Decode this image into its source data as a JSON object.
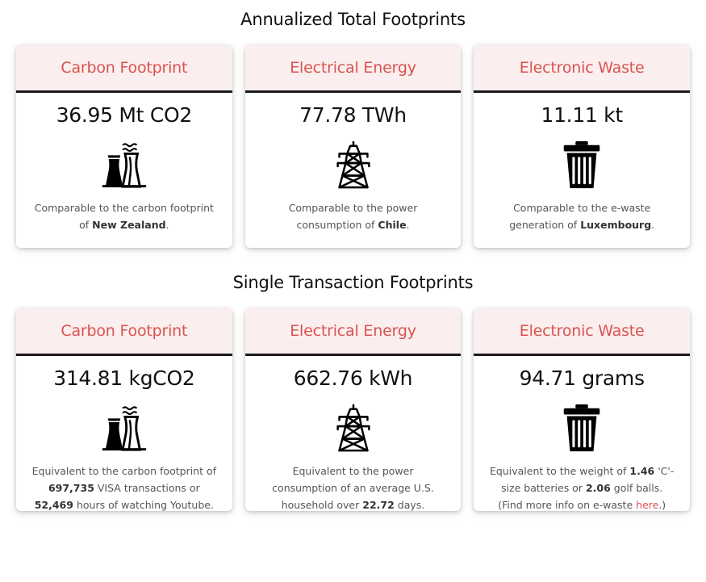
{
  "annual": {
    "title": "Annualized Total Footprints",
    "carbon": {
      "header": "Carbon Footprint",
      "value": "36.95 Mt CO2",
      "icon": "power-plant-icon",
      "desc_prefix": "Comparable to the carbon footprint of",
      "desc_bold": "New Zealand",
      "desc_suffix": "."
    },
    "energy": {
      "header": "Electrical Energy",
      "value": "77.78 TWh",
      "icon": "power-tower-icon",
      "desc_prefix": "Comparable to the power consumption of",
      "desc_bold": "Chile",
      "desc_suffix": "."
    },
    "waste": {
      "header": "Electronic Waste",
      "value": "11.11 kt",
      "icon": "trash-can-icon",
      "desc_prefix": "Comparable to the e-waste generation of",
      "desc_bold": "Luxembourg",
      "desc_suffix": "."
    }
  },
  "single": {
    "title": "Single Transaction Footprints",
    "carbon": {
      "header": "Carbon Footprint",
      "value": "314.81 kgCO2",
      "icon": "power-plant-icon",
      "desc_1": "Equivalent to the carbon footprint of",
      "desc_b1": "697,735",
      "desc_2": "VISA transactions or",
      "desc_b2": "52,469",
      "desc_3": "hours of watching Youtube."
    },
    "energy": {
      "header": "Electrical Energy",
      "value": "662.76 kWh",
      "icon": "power-tower-icon",
      "desc_1": "Equivalent to the power consumption of an average U.S. household over",
      "desc_b1": "22.72",
      "desc_2": "days."
    },
    "waste": {
      "header": "Electronic Waste",
      "value": "94.71 grams",
      "icon": "trash-can-icon",
      "desc_1": "Equivalent to the weight of",
      "desc_b1": "1.46",
      "desc_2": "'C'-size batteries or",
      "desc_b2": "2.06",
      "desc_3": "golf balls. (Find more info on e-waste",
      "link": "here",
      "desc_4": ".)"
    }
  },
  "colors": {
    "accent": "#d9534f",
    "header_bg": "#fbeeee",
    "divider": "#1b1b1b"
  }
}
